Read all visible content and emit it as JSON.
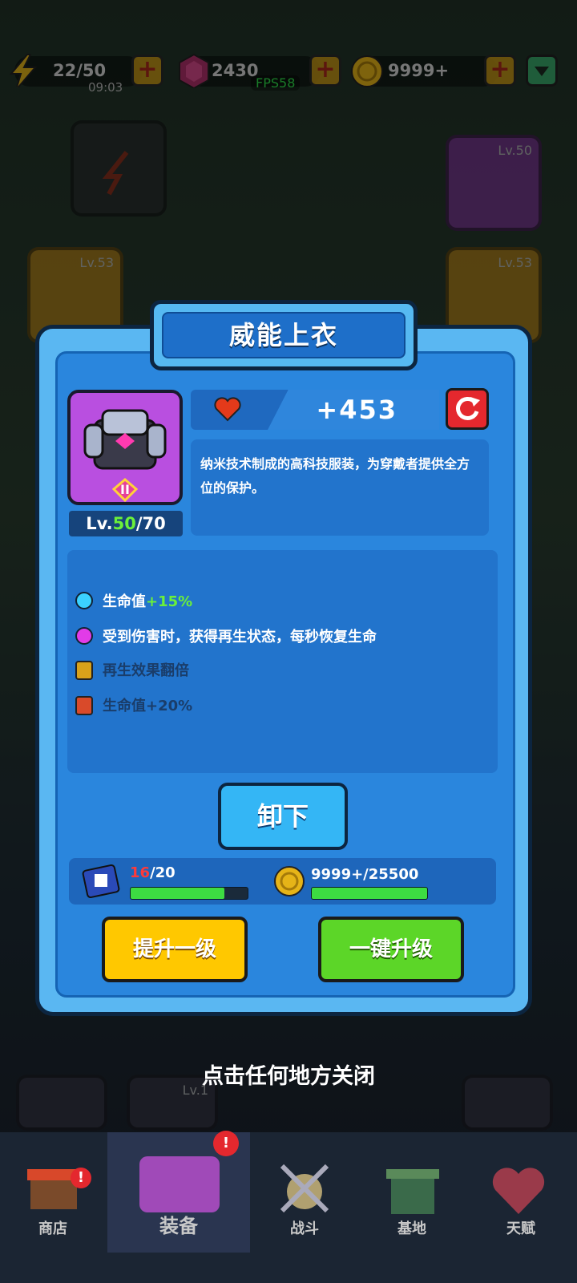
{
  "status": {
    "energy": "22/50",
    "timer": "09:03",
    "gems": "2430",
    "coins": "9999+",
    "fps": "FPS58"
  },
  "bg_slots": {
    "lv50": "Lv.50",
    "lv53a": "Lv.53",
    "lv53b": "Lv.53",
    "lv1": "Lv.1"
  },
  "dialog": {
    "title": "威能上衣",
    "level_prefix": "Lv.",
    "level_current": "50",
    "level_max": "/70",
    "hp_bonus": "+453",
    "description": "纳米技术制成的高科技服装，为穿戴者提供全方位的保护。",
    "stats": [
      {
        "label": "生命值",
        "value": "+15%",
        "color": "#3bd2ff",
        "locked": false
      },
      {
        "label": "受到伤害时，获得再生状态，每秒恢复生命",
        "value": "",
        "color": "#e23be8",
        "locked": false
      },
      {
        "label": "再生效果翻倍",
        "value": "",
        "color": "#d9a21a",
        "locked": true
      },
      {
        "label": "生命值+20%",
        "value": "",
        "color": "#d94a2a",
        "locked": true
      }
    ],
    "unequip_label": "卸下",
    "scrolls_have": "16",
    "scrolls_need": "/20",
    "scroll_progress": 0.8,
    "coins_cost": "9999+/25500",
    "coin_progress": 1.0,
    "upgrade_one_label": "提升一级",
    "upgrade_all_label": "一键升级"
  },
  "close_hint": "点击任何地方关闭",
  "nav": {
    "shop": "商店",
    "equipment": "装备",
    "battle": "战斗",
    "base": "基地",
    "talent": "天赋"
  },
  "colors": {
    "dialog_blue": "#2a86dd",
    "green_text": "#6bf03a",
    "red_text": "#ff3a3a"
  }
}
